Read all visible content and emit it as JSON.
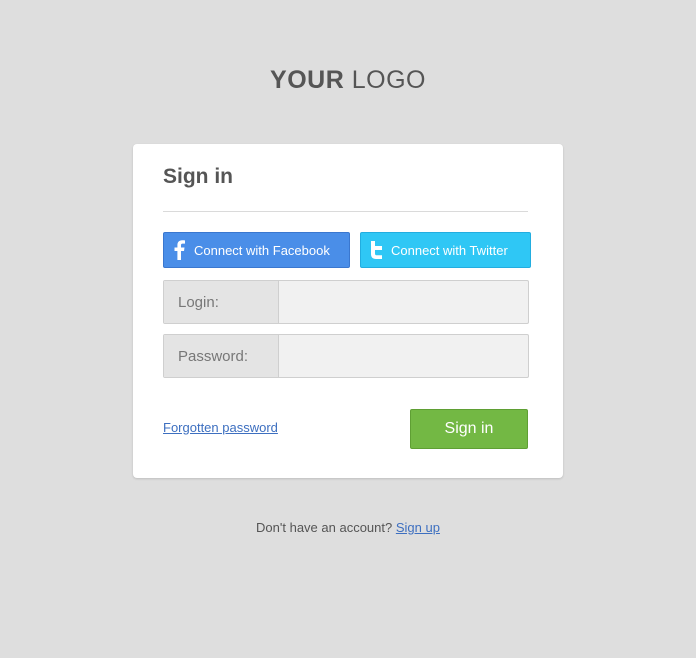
{
  "logo": {
    "bold": "YOUR",
    "light": "LOGO"
  },
  "card": {
    "title": "Sign in",
    "facebook_label": "Connect with Facebook",
    "twitter_label": "Connect with Twitter",
    "login_label": "Login:",
    "login_value": "",
    "password_label": "Password:",
    "password_value": "",
    "forgot_label": "Forgotten password",
    "signin_label": "Sign in"
  },
  "footer": {
    "prompt": "Don't have an account?",
    "signup_label": "Sign up"
  },
  "icons": {
    "facebook": "facebook-icon",
    "twitter": "twitter-icon"
  },
  "colors": {
    "background": "#dedede",
    "facebook": "#4a8ee8",
    "twitter": "#2fc7f5",
    "signin": "#73b844",
    "link": "#3d6fc0"
  }
}
